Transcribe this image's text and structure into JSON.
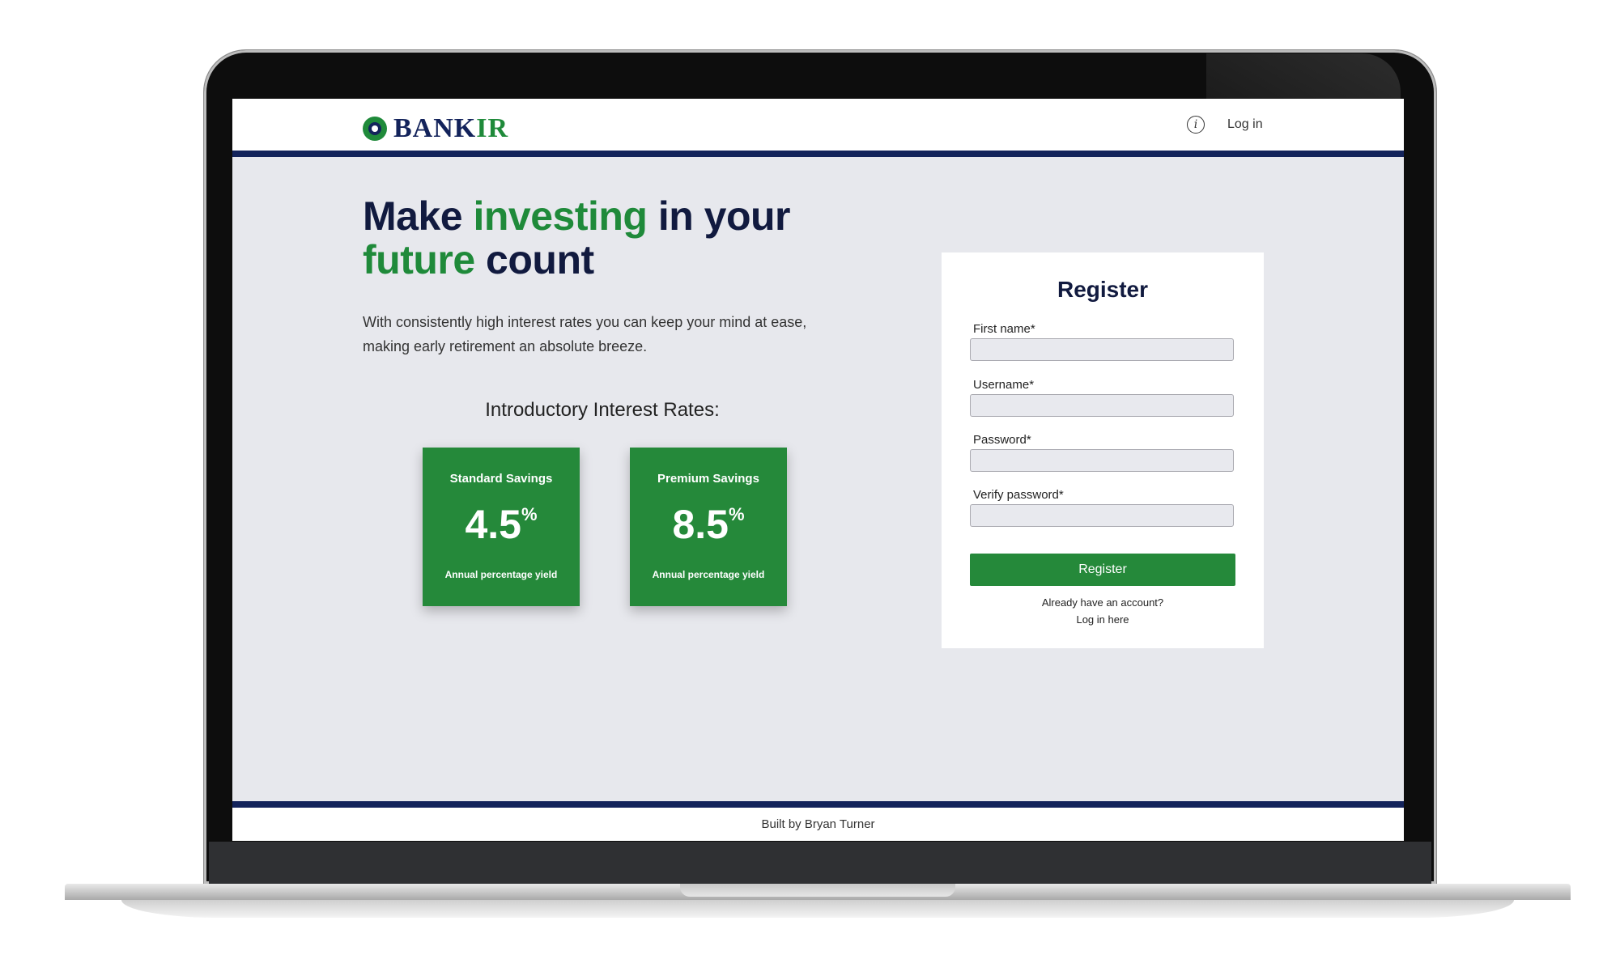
{
  "brand": {
    "name_main": "BANK",
    "name_accent": "IR",
    "colors": {
      "navy": "#13235b",
      "green": "#25893a",
      "background": "#e7e8ed"
    }
  },
  "header": {
    "info_icon": "info-icon",
    "login_label": "Log in"
  },
  "hero": {
    "title_part1": "Make ",
    "title_accent1": "investing",
    "title_part2": " in your ",
    "title_accent2": "future",
    "title_part3": " count",
    "description": "With consistently high interest rates you can keep your mind at ease, making early retirement an absolute breeze."
  },
  "rates": {
    "heading": "Introductory Interest Rates:",
    "cards": [
      {
        "name": "Standard Savings",
        "value": "4.5",
        "unit": "%",
        "caption": "Annual percentage yield"
      },
      {
        "name": "Premium Savings",
        "value": "8.5",
        "unit": "%",
        "caption": "Annual percentage yield"
      }
    ]
  },
  "register": {
    "title": "Register",
    "fields": [
      {
        "label": "First name*",
        "value": ""
      },
      {
        "label": "Username*",
        "value": ""
      },
      {
        "label": "Password*",
        "value": ""
      },
      {
        "label": "Verify password*",
        "value": ""
      }
    ],
    "submit_label": "Register",
    "have_account": "Already have an account?",
    "login_link": "Log in here"
  },
  "footer": {
    "text": "Built by Bryan Turner"
  }
}
